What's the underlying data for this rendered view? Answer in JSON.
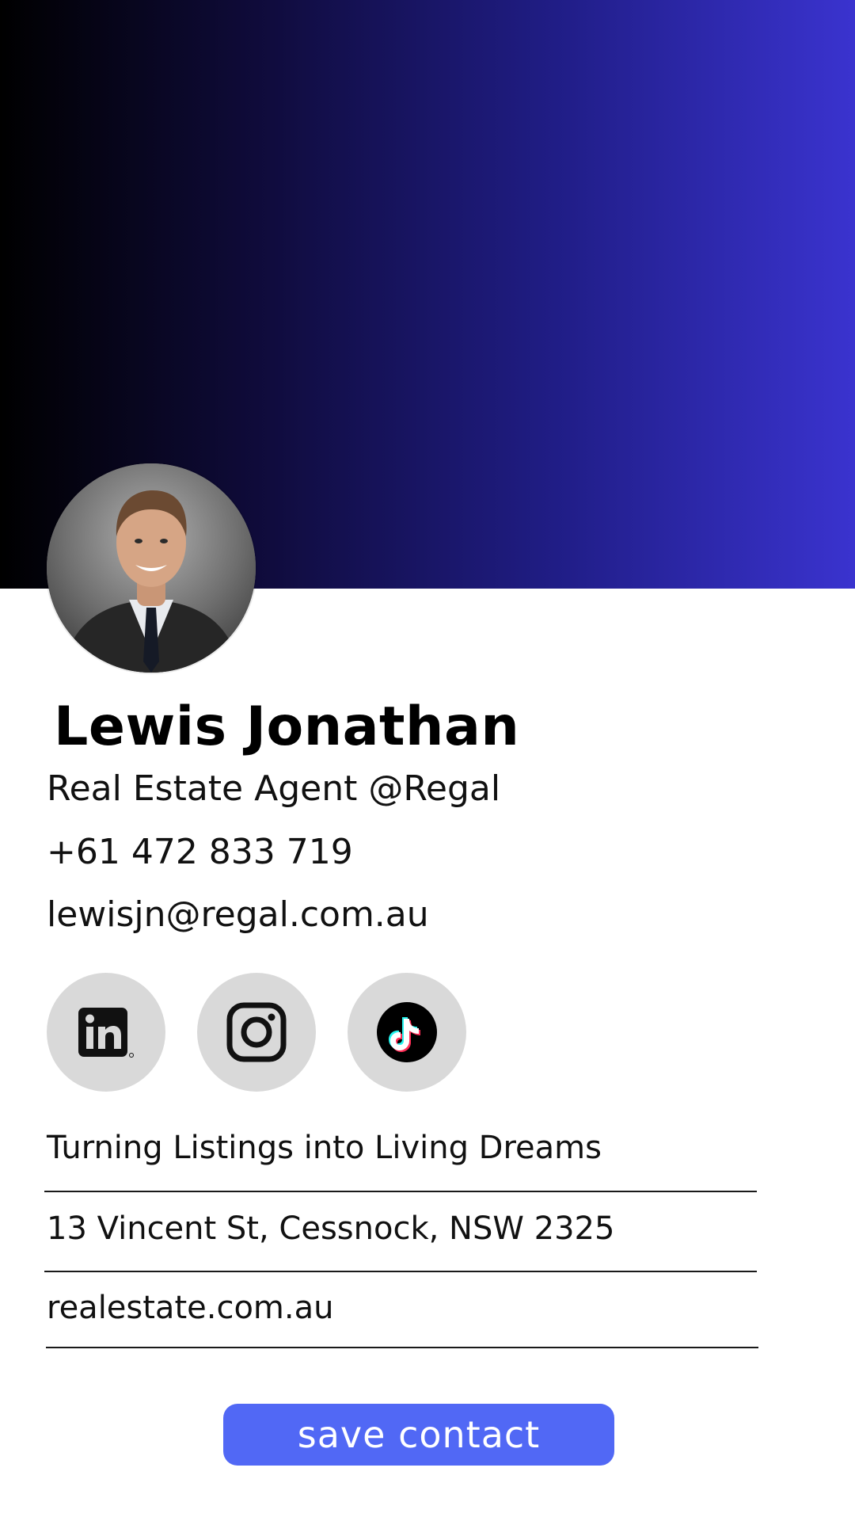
{
  "colors": {
    "header_gradient_start": "#000000",
    "header_gradient_end": "#3a33cf",
    "social_bg": "#d9d9d9",
    "button_bg": "#5168f5",
    "button_text": "#ffffff"
  },
  "profile": {
    "name": "Lewis Jonathan",
    "title": "Real Estate Agent @Regal",
    "phone": "+61 472 833 719",
    "email": "lewisjn@regal.com.au"
  },
  "social": [
    {
      "icon": "linkedin-icon"
    },
    {
      "icon": "instagram-icon"
    },
    {
      "icon": "tiktok-icon"
    }
  ],
  "info": {
    "tagline": "Turning Listings into Living Dreams",
    "address": "13 Vincent St, Cessnock, NSW 2325",
    "website": "realestate.com.au"
  },
  "actions": {
    "save_label": "save contact"
  }
}
